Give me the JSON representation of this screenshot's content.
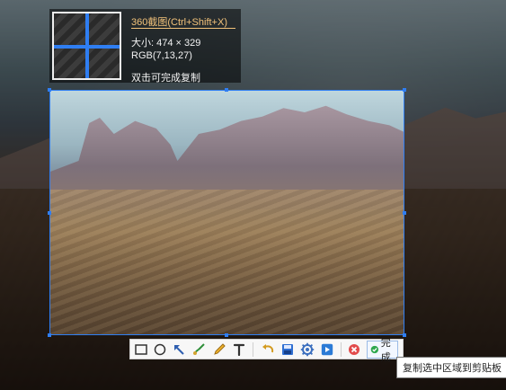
{
  "screenshot_tool": {
    "info_panel": {
      "title": "360截图(Ctrl+Shift+X)",
      "size_label": "大小: 474 × 329",
      "rgb_label": "RGB(7,13,27)",
      "hint_label": "双击可完成复制"
    },
    "toolbar": {
      "tools": [
        {
          "name": "rectangle-tool",
          "icon": "rectangle-outline"
        },
        {
          "name": "ellipse-tool",
          "icon": "circle-outline"
        },
        {
          "name": "arrow-tool",
          "icon": "arrow-northwest"
        },
        {
          "name": "brush-tool",
          "icon": "brush"
        },
        {
          "name": "pen-tool",
          "icon": "pencil"
        },
        {
          "name": "text-tool",
          "icon": "text-T"
        }
      ],
      "actions": [
        {
          "name": "undo-action",
          "icon": "undo"
        },
        {
          "name": "save-action",
          "icon": "save"
        },
        {
          "name": "settings-action",
          "icon": "gear"
        },
        {
          "name": "share-action",
          "icon": "share"
        },
        {
          "name": "cancel-action",
          "icon": "close"
        }
      ],
      "done_label": "完成"
    },
    "tooltip": "复制选中区域到剪贴板"
  },
  "colors": {
    "selection_border": "#2f7ef2",
    "title_accent": "#f2c27a",
    "toolbar_bg": "#f7f7f7",
    "cancel_red": "#e24b4b",
    "done_green": "#2fa84f"
  }
}
